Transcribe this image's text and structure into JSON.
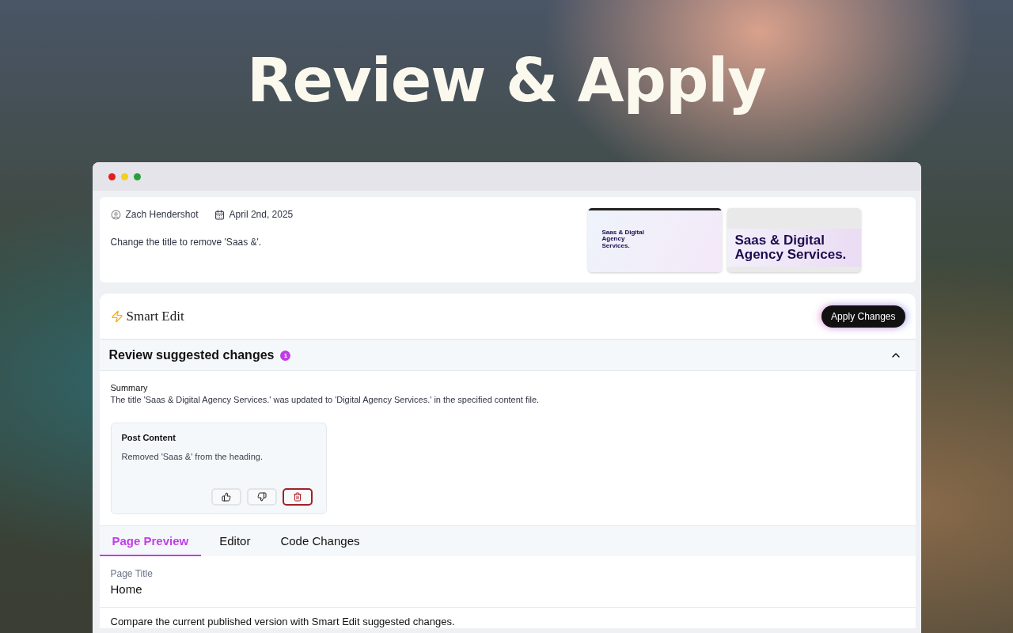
{
  "hero": {
    "title": "Review & Apply"
  },
  "request": {
    "author": "Zach Hendershot",
    "date": "April 2nd, 2025",
    "message": "Change the title to remove 'Saas &'.",
    "thumbnails": [
      {
        "kind": "page",
        "heading": "Saas & Digital Agency Services."
      },
      {
        "kind": "crop",
        "heading": "Saas & Digital Agency Services."
      }
    ]
  },
  "smart_edit": {
    "title": "Smart Edit",
    "apply_button": "Apply Changes"
  },
  "review": {
    "title": "Review suggested changes",
    "count": "1",
    "expanded": true,
    "summary_label": "Summary",
    "summary": "The title 'Saas & Digital Agency Services.' was updated to 'Digital Agency Services.' in the specified content file.",
    "change": {
      "title": "Post Content",
      "description": "Removed 'Saas &' from the heading.",
      "actions": [
        {
          "kind": "like"
        },
        {
          "kind": "dislike"
        },
        {
          "kind": "delete"
        }
      ]
    }
  },
  "tabs": [
    {
      "label": "Page Preview",
      "selected": true
    },
    {
      "label": "Editor",
      "selected": false
    },
    {
      "label": "Code Changes",
      "selected": false
    }
  ],
  "preview": {
    "field_label": "Page Title",
    "field_value": "Home",
    "note": "Compare the current published version with Smart Edit suggested changes."
  }
}
